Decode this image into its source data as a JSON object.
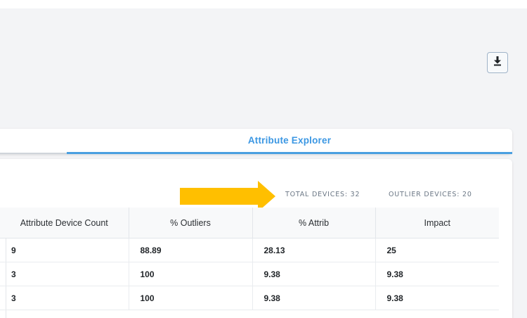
{
  "toolbar": {
    "download_icon": "download-icon"
  },
  "tabs": [
    {
      "label": "",
      "active": false
    },
    {
      "label": "Attribute Explorer",
      "active": true
    }
  ],
  "stats": {
    "total_devices": "TOTAL DEVICES: 32",
    "outlier_devices": "OUTLIER DEVICES: 20"
  },
  "annotation": {
    "arrow_color": "#ffbf00"
  },
  "colors": {
    "accent": "#3b97e3",
    "tab_underline": "#4a9fe0"
  },
  "table": {
    "headers": [
      "Attribute Device Count",
      "% Outliers",
      "% Attrib",
      "Impact"
    ],
    "rows": [
      [
        "9",
        "88.89",
        "28.13",
        "25"
      ],
      [
        "3",
        "100",
        "9.38",
        "9.38"
      ],
      [
        "3",
        "100",
        "9.38",
        "9.38"
      ]
    ]
  }
}
